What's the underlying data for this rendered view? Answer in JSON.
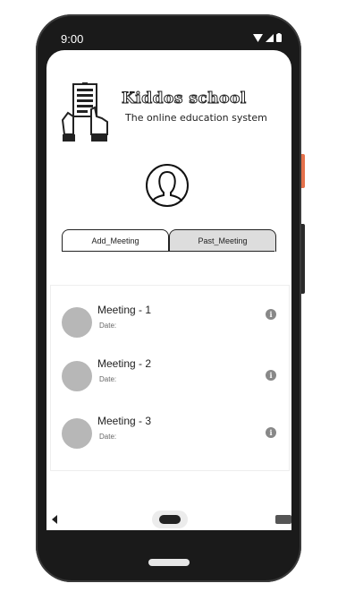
{
  "status_bar": {
    "time": "9:00"
  },
  "brand": {
    "title": "Kiddos school",
    "subtitle": "The online education system"
  },
  "tabs": [
    {
      "label": "Add_Meeting",
      "active": true
    },
    {
      "label": "Past_Meeting",
      "active": false
    }
  ],
  "meetings": [
    {
      "title": "Meeting - 1",
      "date_label": "Date:"
    },
    {
      "title": "Meeting - 2",
      "date_label": "Date:"
    },
    {
      "title": "Meeting - 3",
      "date_label": "Date:"
    }
  ],
  "icons": {
    "logo": "document-hands-icon",
    "profile": "user-profile-icon",
    "info": "info-icon",
    "wifi": "wifi-icon",
    "signal": "signal-icon",
    "battery": "battery-icon"
  },
  "colors": {
    "side_button_accent": "#e5714b",
    "inactive_tab": "#dddddd",
    "avatar_placeholder": "#b7b7b7"
  }
}
